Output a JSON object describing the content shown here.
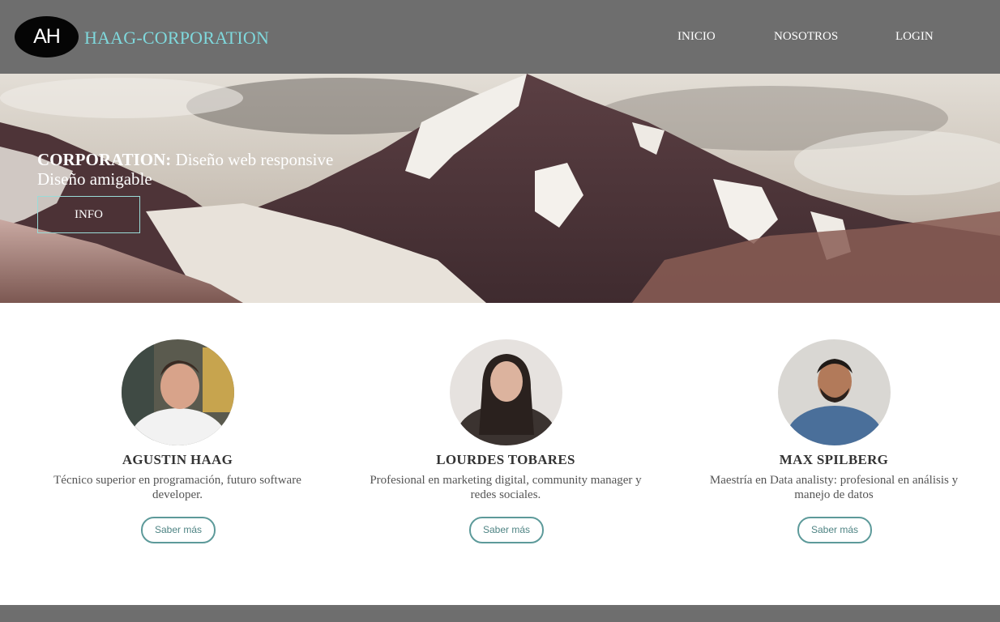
{
  "header": {
    "logo_text": "AH",
    "brand": "HAAG-CORPORATION",
    "nav": [
      "INICIO",
      "NOSOTROS",
      "LOGIN"
    ]
  },
  "hero": {
    "title_bold": "CORPORATION:",
    "title_rest": " Diseño web responsive",
    "subtitle": "Diseño amigable",
    "button_label": "INFO"
  },
  "team": [
    {
      "name": "AGUSTIN HAAG",
      "description": "Técnico superior en programación, futuro software developer.",
      "button_label": "Saber más"
    },
    {
      "name": "LOURDES TOBARES",
      "description": "Profesional en marketing digital, community manager y redes sociales.",
      "button_label": "Saber más"
    },
    {
      "name": "MAX SPILBERG",
      "description": "Maestría en Data analisty: profesional en análisis y manejo de datos",
      "button_label": "Saber más"
    }
  ],
  "colors": {
    "header_bg": "#6e6e6e",
    "brand_accent": "#7fd8dc",
    "button_border": "#5d9a9a"
  }
}
